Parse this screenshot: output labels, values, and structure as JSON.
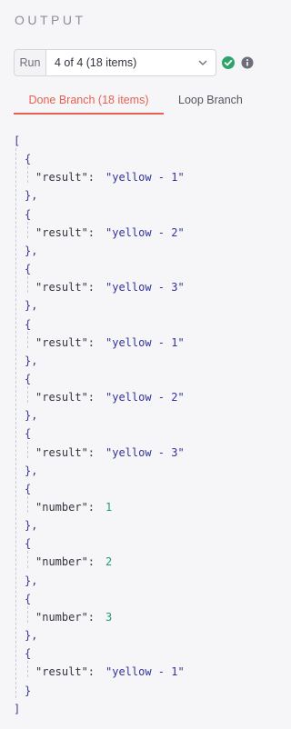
{
  "header": {
    "title": "OUTPUT"
  },
  "run": {
    "label": "Run",
    "selected": "4 of 4 (18 items)",
    "status_icon": "check-circle-icon",
    "status_color": "#2ea36a",
    "info_icon": "info-icon"
  },
  "tabs": [
    {
      "label": "Done Branch (18 items)",
      "active": true
    },
    {
      "label": "Loop Branch",
      "active": false
    }
  ],
  "colors": {
    "accent": "#e8604f",
    "number": "#1b9e72",
    "string": "#33339a"
  },
  "output": {
    "open_bracket": "[",
    "close_bracket": "]",
    "items": [
      {
        "key": "\"result\":",
        "value": "\"yellow - 1\"",
        "type": "string"
      },
      {
        "key": "\"result\":",
        "value": "\"yellow - 2\"",
        "type": "string"
      },
      {
        "key": "\"result\":",
        "value": "\"yellow - 3\"",
        "type": "string"
      },
      {
        "key": "\"result\":",
        "value": "\"yellow - 1\"",
        "type": "string"
      },
      {
        "key": "\"result\":",
        "value": "\"yellow - 2\"",
        "type": "string"
      },
      {
        "key": "\"result\":",
        "value": "\"yellow - 3\"",
        "type": "string"
      },
      {
        "key": "\"number\":",
        "value": "1",
        "type": "number"
      },
      {
        "key": "\"number\":",
        "value": "2",
        "type": "number"
      },
      {
        "key": "\"number\":",
        "value": "3",
        "type": "number"
      },
      {
        "key": "\"result\":",
        "value": "\"yellow - 1\"",
        "type": "string"
      }
    ]
  }
}
